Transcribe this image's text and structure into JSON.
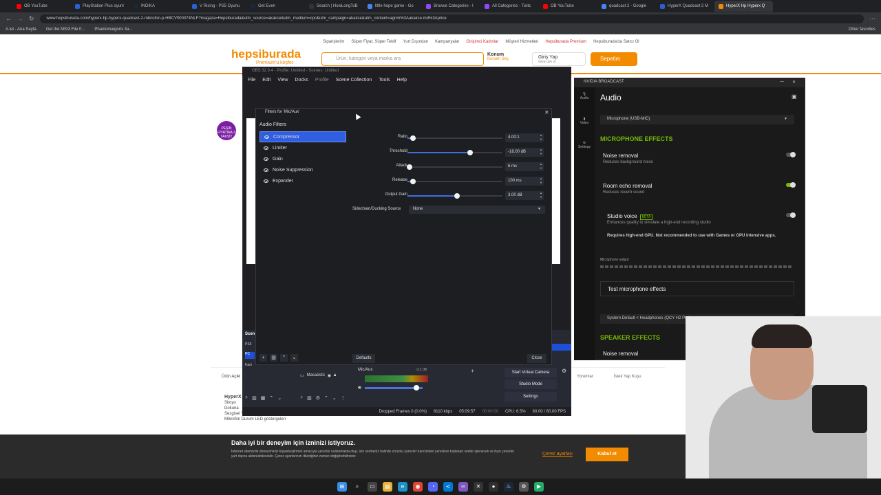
{
  "browser": {
    "tabs": [
      {
        "label": "OB YouTube",
        "color": "#ff0000"
      },
      {
        "label": "PlayStation Plus oyunl",
        "color": "#2d5fd4"
      },
      {
        "label": "INDIKA",
        "color": "#1b2838"
      },
      {
        "label": "V Rising - PS5 Oyunu",
        "color": "#2d5fd4"
      },
      {
        "label": "Get Even",
        "color": "#1b2838"
      },
      {
        "label": "Search | HowLongToB",
        "color": "#333"
      },
      {
        "label": "little hope game - Go",
        "color": "#4285f4"
      },
      {
        "label": "Browse Categories - I",
        "color": "#9146ff"
      },
      {
        "label": "All Categories - Twitc",
        "color": "#9146ff"
      },
      {
        "label": "OB YouTube",
        "color": "#ff0000"
      },
      {
        "label": "quadcast 2 - Google",
        "color": "#4285f4"
      },
      {
        "label": "HyperX Quadcast 2 M",
        "color": "#2d5fd4"
      },
      {
        "label": "HyperX Hp Hyperx Q",
        "color": "#f28b00"
      }
    ],
    "url": "www.hepsiburada.com/hyperx-hp-hyperx-quadcast-2-mikrofon-p-HBCV000074NLF?magaza=Hepsiburada&utm_source=akakce&utm_medium=cpc&utm_campaign=akakce&utm_content=agnm%3Aakakce.md%3Aprice",
    "bookmarks": [
      "A.let - Ana Sayfa",
      "Get the MSI3 File fr...",
      "Phantomalgorix 3a..."
    ],
    "other_favorites": "Other favorites"
  },
  "site": {
    "logo": "hepsiburada",
    "logo_sub": "Premium'u keşfet",
    "nav": [
      "Siparişlerim",
      "Süper Fiyat, Süper Teklif",
      "Yurt Dışından",
      "Kampanyalar",
      "Girişimci Kadınlar",
      "Müşteri Hizmetleri",
      "Hepsiburada Premium",
      "Hepsiburada'da Satıcı Ol"
    ],
    "search_placeholder": "Ürün, kategori veya marka ara",
    "location_title": "Konum",
    "location_sub": "Konum Seç",
    "login_title": "Giriş Yap",
    "login_sub": "veya üye ol",
    "cart": "Sepetim",
    "badge": "PEŞİN FİYATINA 3 TAKSİT",
    "product_tab": "Ürün Açıkl",
    "product_tabs_right": [
      "Yorumlar",
      "İstek Yap Kuşu"
    ],
    "product_name": "HyperX",
    "product_desc": [
      "Sitoyo",
      "Dokuna",
      "Sezgisel Yeni Çalıştırma",
      "Mikrofon Durum LED göstergeleri"
    ]
  },
  "cookie": {
    "title": "Daha iyi bir deneyim için izninizi istiyoruz.",
    "text": "İnternet sitemizde deneyiminizi kişiselleştirmek amacıyla çerezler kullanmakta olup, izin vermeniz halinde zorunlu çerezler haricindeki çerezlere toplanan veriler işlenecek ve bazı çerezler yurt dışına aktarılabilecektir. Çerez ayarlarınızı dilediğiniz zaman değiştirebilirsiniz.",
    "settings": "Çerez ayarları",
    "accept": "Kabul et"
  },
  "obs": {
    "title": "OBS 32.0.4 - Profile: Untitled - Scenes: Untitled",
    "menu": [
      "File",
      "Edit",
      "View",
      "Docks",
      "Profile",
      "Scene Collection",
      "Tools",
      "Help"
    ],
    "scenes_label": "Scen",
    "scene_items": [
      "PS5",
      "PC",
      "Kam"
    ],
    "source": "Masaüstü",
    "mixer_name": "Mic/Aux",
    "mixer_db": "-3.1 dB",
    "buttons": [
      "Start Virtual Camera",
      "Studio Mode",
      "Settings"
    ],
    "status": {
      "dropped": "Dropped Frames 0 (0.0%)",
      "kbps": "8110 kbps",
      "rec": "05:09:57",
      "stream": "00:00:00",
      "cpu": "CPU: 6.5%",
      "fps": "60.00 / 60.00 FPS"
    }
  },
  "filters": {
    "title": "Filters for 'Mic/Aux'",
    "list_label": "Audio Filters",
    "items": [
      "Compressor",
      "Limiter",
      "Gain",
      "Noise Suppression",
      "Expander"
    ],
    "selected": "Compressor",
    "props": [
      {
        "label": "Ratio",
        "value": "4.00:1",
        "fraction": 0.06
      },
      {
        "label": "Threshold",
        "value": "-18.00 dB",
        "fraction": 0.66
      },
      {
        "label": "Attack",
        "value": "6 ms",
        "fraction": 0.02
      },
      {
        "label": "Release",
        "value": "100 ms",
        "fraction": 0.06
      },
      {
        "label": "Output Gain",
        "value": "3.00 dB",
        "fraction": 0.52
      }
    ],
    "sidechain_label": "Sidechain/Ducking Source",
    "sidechain_value": "None",
    "defaults": "Defaults",
    "close": "Close"
  },
  "nvidia": {
    "title": "NVIDIA BROADCAST",
    "side": [
      "Audio",
      "Video",
      "Settings"
    ],
    "heading": "Audio",
    "mic_device": "Microphone (USB-MIC)",
    "mic_section": "MICROPHONE EFFECTS",
    "effects": [
      {
        "title": "Noise removal",
        "sub": "Reduces background noise",
        "on": false
      },
      {
        "title": "Room echo removal",
        "sub": "Reduces reverb sound",
        "on": true
      },
      {
        "title": "Studio voice",
        "sub": "Enhances quality to simulate a high-end recording studio",
        "on": false
      }
    ],
    "beta": "BETA",
    "warning": "Requires high-end GPU. Not recommended to use with Games or GPU intensive apps.",
    "output_label": "Microphone output",
    "test": "Test microphone effects",
    "speaker_device": "System Default < Headphones (QCY H2 Pro) >",
    "speaker_section": "SPEAKER EFFECTS",
    "speaker_effect": "Noise removal"
  }
}
